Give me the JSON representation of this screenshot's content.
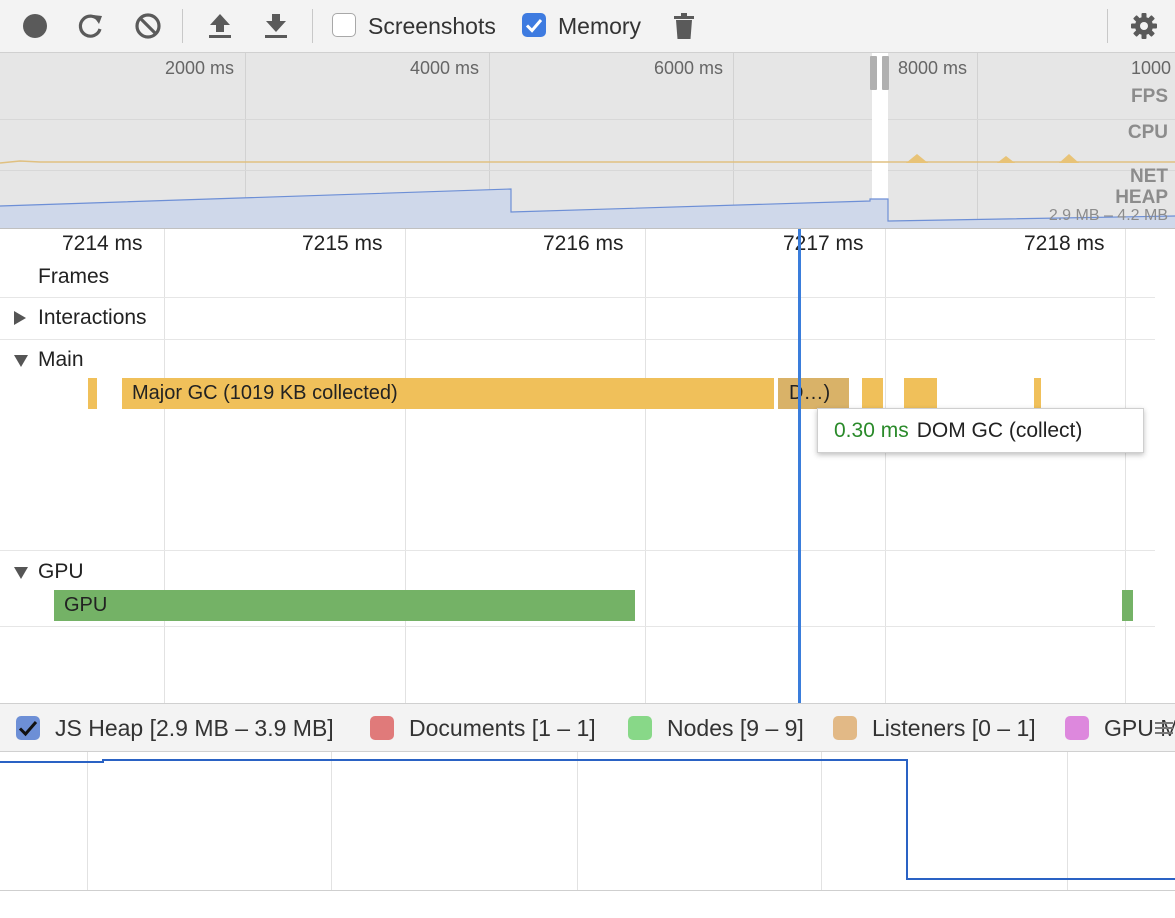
{
  "toolbar": {
    "screenshots_label": "Screenshots",
    "screenshots_checked": false,
    "memory_label": "Memory",
    "memory_checked": true
  },
  "overview": {
    "ticks": [
      "2000 ms",
      "4000 ms",
      "6000 ms",
      "8000 ms",
      "1000"
    ],
    "lanes": [
      "FPS",
      "CPU",
      "NET",
      "HEAP"
    ],
    "heap_range": "2.9 MB – 4.2 MB"
  },
  "flame": {
    "ticks": [
      "7214 ms",
      "7215 ms",
      "7216 ms",
      "7217 ms",
      "7218 ms"
    ],
    "tracks": {
      "frames": "Frames",
      "interactions": "Interactions",
      "main": "Main",
      "gpu": "GPU"
    },
    "bars": {
      "major_gc": "Major GC (1019 KB collected)",
      "dom_gc_short": "D…)",
      "gpu": "GPU"
    },
    "tooltip": {
      "duration": "0.30 ms",
      "title": "DOM GC (collect)"
    }
  },
  "counters": {
    "items": [
      {
        "label": "JS Heap [2.9 MB – 3.9 MB]",
        "color": "#6d8fd6",
        "checked": true
      },
      {
        "label": "Documents [1 – 1]",
        "color": "#e07a7a",
        "checked": false
      },
      {
        "label": "Nodes [9 – 9]",
        "color": "#88d888",
        "checked": false
      },
      {
        "label": "Listeners [0 – 1]",
        "color": "#e2b986",
        "checked": false
      },
      {
        "label": "GPU M",
        "color": "#dd88dd",
        "checked": false
      }
    ]
  },
  "colors": {
    "accent": "#3a7ddb",
    "gc": "#f0c05a",
    "gpu": "#74b266",
    "tooltip_duration": "#2a8a2a"
  }
}
